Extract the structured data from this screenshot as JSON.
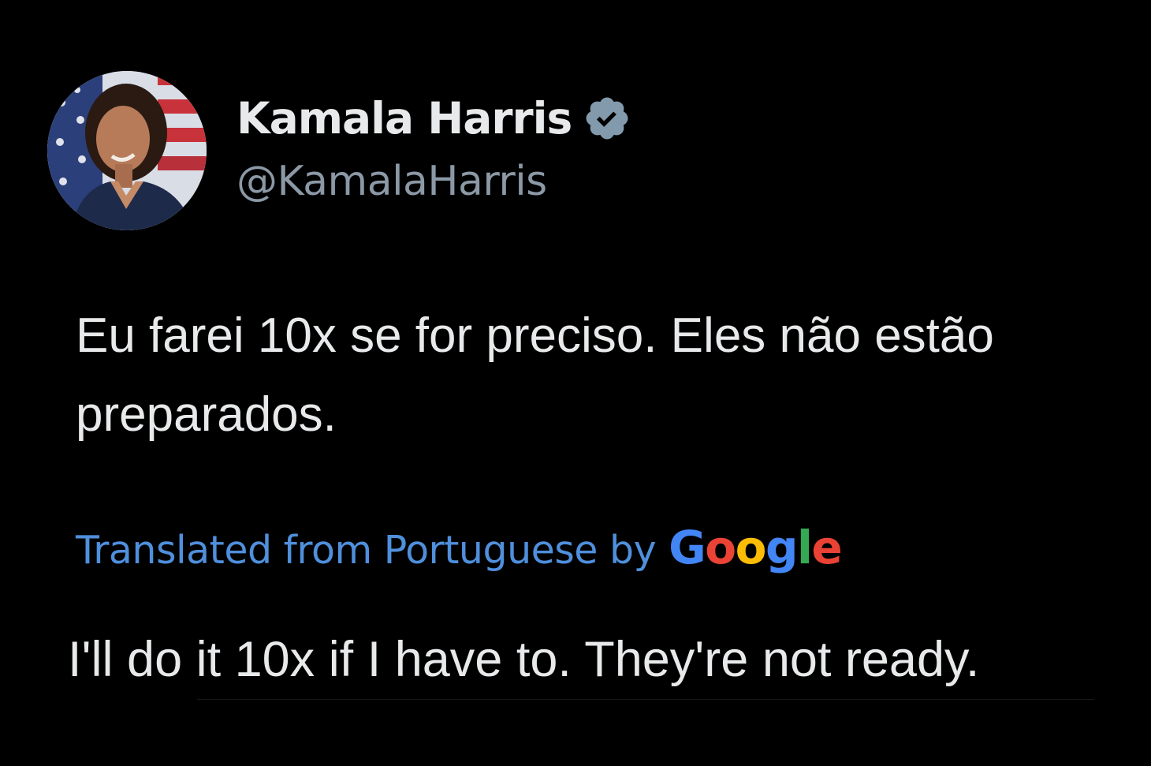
{
  "tweet": {
    "author": {
      "display_name": "Kamala Harris",
      "handle": "@KamalaHarris",
      "verified": true,
      "verified_icon": "verified-badge-icon"
    },
    "text": "Eu farei 10x se for preciso. Eles não estão preparados.",
    "translation": {
      "label": "Translated from Portuguese by",
      "provider": "Google",
      "text": "I'll do it 10x if I have to. They're not ready."
    }
  },
  "colors": {
    "background": "#000000",
    "primary_text": "#e7e9ea",
    "secondary_text": "#8b98a5",
    "link": "#4f8fdc",
    "google_blue": "#4285F4",
    "google_red": "#EA4335",
    "google_yellow": "#FBBC05",
    "google_green": "#34A853"
  }
}
